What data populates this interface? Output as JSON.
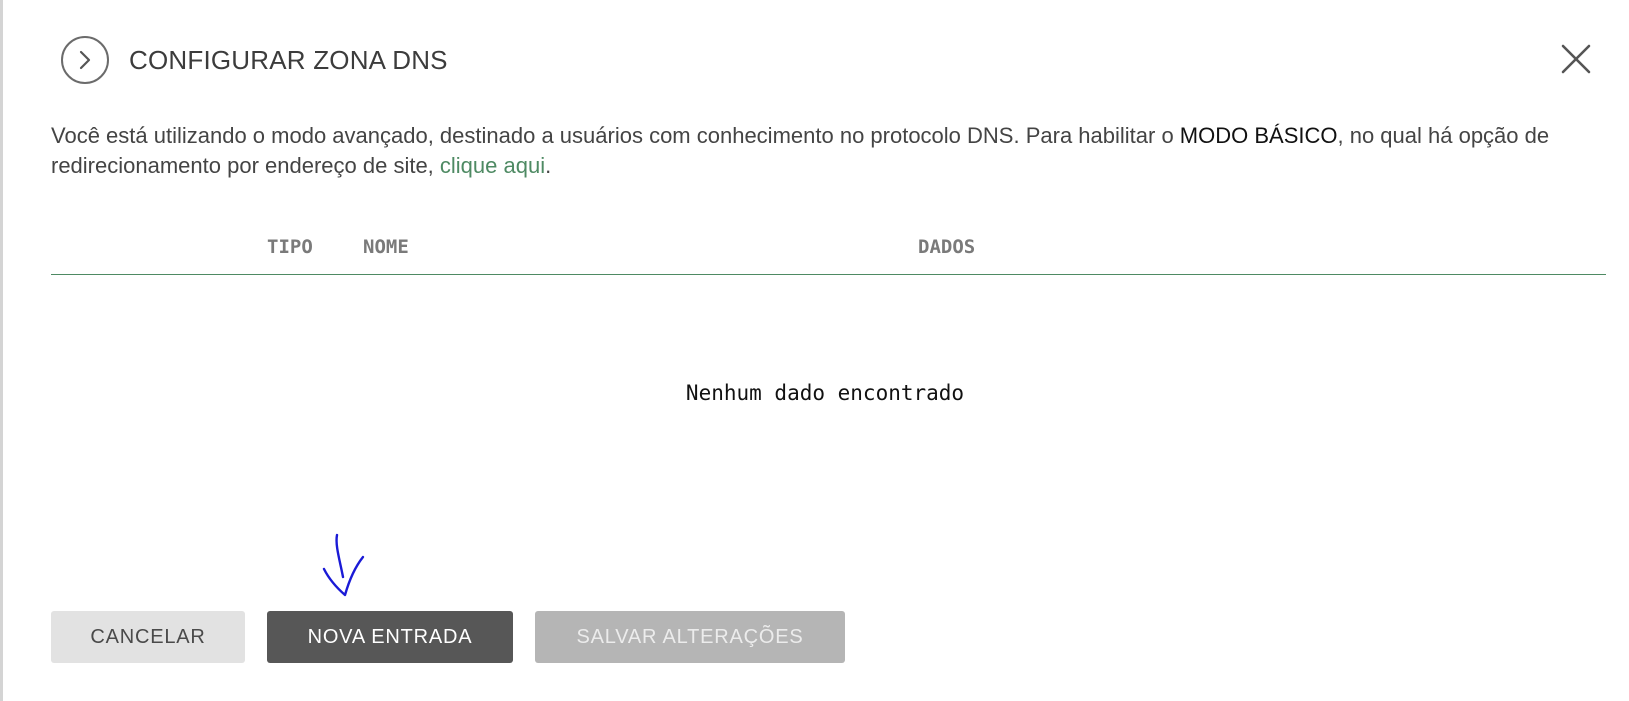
{
  "dialog": {
    "title": "CONFIGURAR ZONA DNS"
  },
  "info": {
    "text_before": "Você está utilizando o modo avançado, destinado a usuários com conhecimento no protocolo DNS. Para habilitar o ",
    "mode_name": "MODO BÁSICO",
    "text_middle": ", no qual há opção de redirecionamento por endereço de site, ",
    "link_text": "clique aqui",
    "text_after": "."
  },
  "table": {
    "columns": [
      "TIPO",
      "NOME",
      "DADOS"
    ],
    "empty_message": "Nenhum dado encontrado"
  },
  "actions": {
    "cancel_label": "CANCELAR",
    "new_entry_label": "NOVA ENTRADA",
    "save_label": "SALVAR ALTERAÇÕES"
  },
  "icons": {
    "back": "chevron-right-icon",
    "close": "close-icon",
    "annotation": "hand-drawn-arrow-icon"
  },
  "colors": {
    "accent_green": "#4e8a63",
    "primary_button": "#575757",
    "disabled_button": "#b5b5b5",
    "annotation_blue": "#1a1ad6"
  }
}
